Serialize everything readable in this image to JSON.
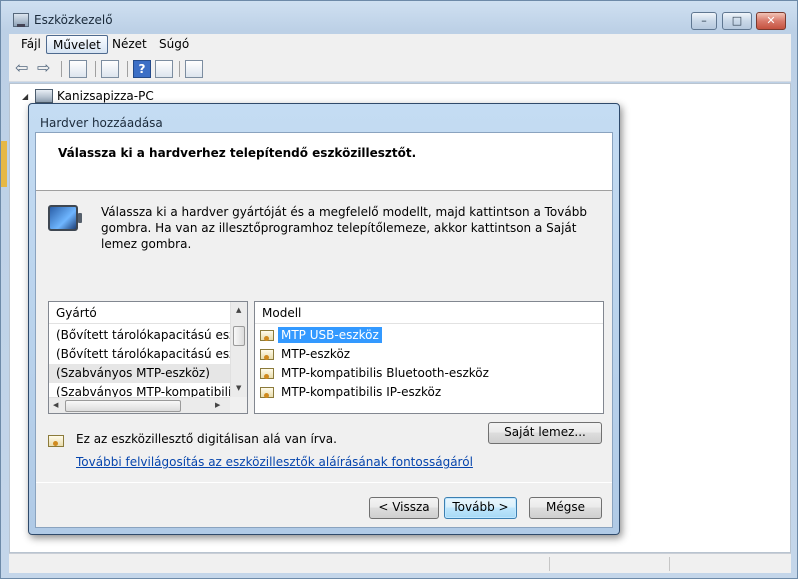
{
  "window": {
    "title": "Eszközkezelő",
    "controls": {
      "minimize": "–",
      "maximize": "□",
      "close": "✕"
    }
  },
  "menubar": {
    "items": [
      "Fájl",
      "Művelet",
      "Nézet",
      "Súgó"
    ],
    "active": "Művelet"
  },
  "toolbar": {
    "buttons": [
      "back-arrow-icon",
      "forward-arrow-icon",
      "console-tree-icon",
      "properties-icon",
      "help-icon",
      "action-pane-icon",
      "scan-hardware-icon"
    ],
    "help_glyph": "?"
  },
  "tree": {
    "expander": "◢",
    "root": "Kanizsapizza-PC"
  },
  "dialog": {
    "title": "Hardver hozzáadása",
    "header": "Válassza ki a hardverhez telepítendő eszközillesztőt.",
    "instructions": "Válassza ki a hardver gyártóját és a megfelelő modellt, majd kattintson a Tovább gombra. Ha van az illesztőprogramhoz telepítőlemeze, akkor kattintson a Saját lemez gombra.",
    "manufacturer": {
      "header": "Gyártó",
      "items": [
        "(Bővített tárolókapacitású eszköz",
        "(Bővített tárolókapacitású eszköz",
        "(Szabványos MTP-eszköz)",
        "(Szabványos MTP-kompatibilis e"
      ],
      "selected_index": 2
    },
    "model": {
      "header": "Modell",
      "items": [
        "MTP USB-eszköz",
        "MTP-eszköz",
        "MTP-kompatibilis Bluetooth-eszköz",
        "MTP-kompatibilis IP-eszköz"
      ],
      "selected_index": 0
    },
    "signed_text": "Ez az eszközillesztő digitálisan alá van írva.",
    "link": "További felvilágosítás az eszközillesztők aláírásának fontosságáról",
    "buttons": {
      "have_disk": "Saját lemez...",
      "back": "< Vissza",
      "next": "Tovább >",
      "cancel": "Mégse"
    }
  },
  "colors": {
    "selection": "#3399ff",
    "link": "#0645ad",
    "title_gradient": "#c4dcf3"
  }
}
